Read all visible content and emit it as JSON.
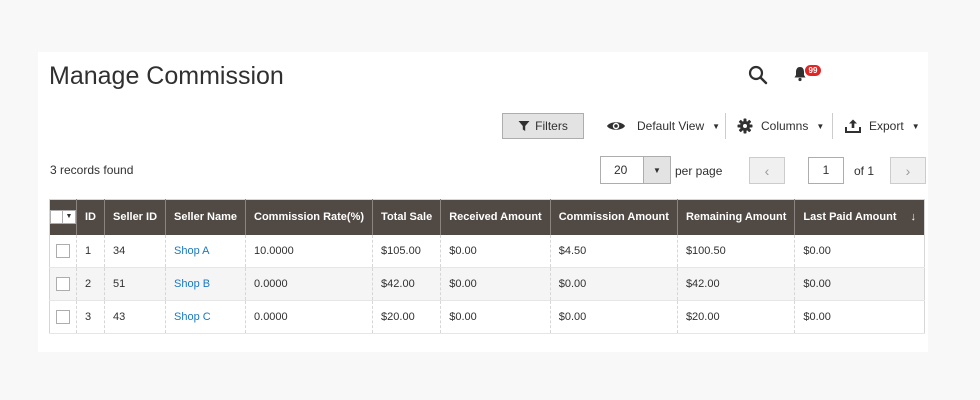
{
  "header": {
    "title": "Manage Commission",
    "notifications_count": "99"
  },
  "toolbar": {
    "filters_label": "Filters",
    "view_label": "Default View",
    "columns_label": "Columns",
    "export_label": "Export"
  },
  "grid_info": {
    "records_found": "3 records found",
    "per_page_value": "20",
    "per_page_label": "per page",
    "current_page": "1",
    "of_pages": "of 1"
  },
  "table": {
    "columns": [
      "ID",
      "Seller ID",
      "Seller Name",
      "Commission Rate(%)",
      "Total Sale",
      "Received Amount",
      "Commission Amount",
      "Remaining Amount",
      "Last Paid Amount"
    ],
    "sort_indicator": "↓",
    "rows": [
      [
        "1",
        "34",
        "Shop A",
        "10.0000",
        "$105.00",
        "$0.00",
        "$4.50",
        "$100.50",
        "$0.00"
      ],
      [
        "2",
        "51",
        "Shop B",
        "0.0000",
        "$42.00",
        "$0.00",
        "$0.00",
        "$42.00",
        "$0.00"
      ],
      [
        "3",
        "43",
        "Shop C",
        "0.0000",
        "$20.00",
        "$0.00",
        "$0.00",
        "$20.00",
        "$0.00"
      ]
    ]
  },
  "icons": {
    "search": "search-icon",
    "notifications": "bell-icon",
    "filter": "funnel-icon",
    "view": "eye-icon",
    "columns": "gear-icon",
    "export": "upload-icon"
  },
  "colors": {
    "table_header_bg": "#514943",
    "link": "#1979c3",
    "badge": "#e22626"
  }
}
